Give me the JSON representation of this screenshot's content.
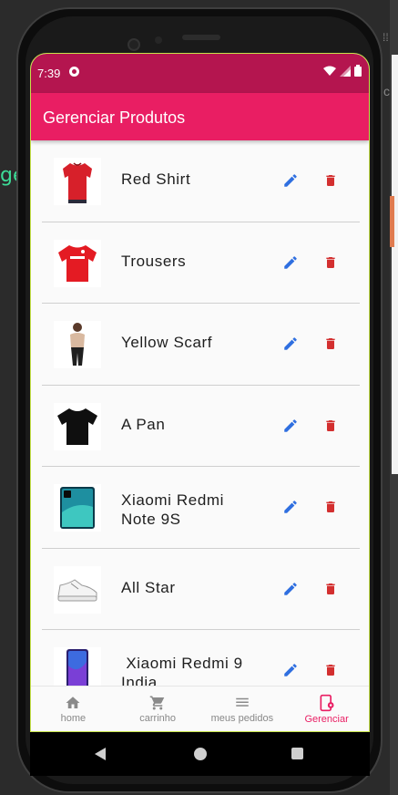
{
  "status": {
    "time": "7:39"
  },
  "appbar": {
    "title": "Gerenciar Produtos"
  },
  "products": [
    {
      "name": "Red Shirt",
      "image": "red-shirt"
    },
    {
      "name": "Trousers",
      "image": "red-jersey"
    },
    {
      "name": "Yellow Scarf",
      "image": "woman-beige"
    },
    {
      "name": "A Pan",
      "image": "black-tshirt"
    },
    {
      "name": "Xiaomi Redmi Note 9S",
      "image": "phone-teal"
    },
    {
      "name": "All Star",
      "image": "white-sneaker"
    },
    {
      "name": " Xiaomi Redmi 9 India",
      "image": "phone-blue"
    }
  ],
  "nav": {
    "home": "home",
    "cart": "carrinho",
    "orders": "meus pedidos",
    "manage": "Gerenciar"
  },
  "colors": {
    "primary": "#e91e63",
    "statusbar": "#b4154f",
    "edit": "#2f6fe0",
    "delete": "#d32f2f"
  },
  "background": {
    "partial_text": "ge"
  }
}
